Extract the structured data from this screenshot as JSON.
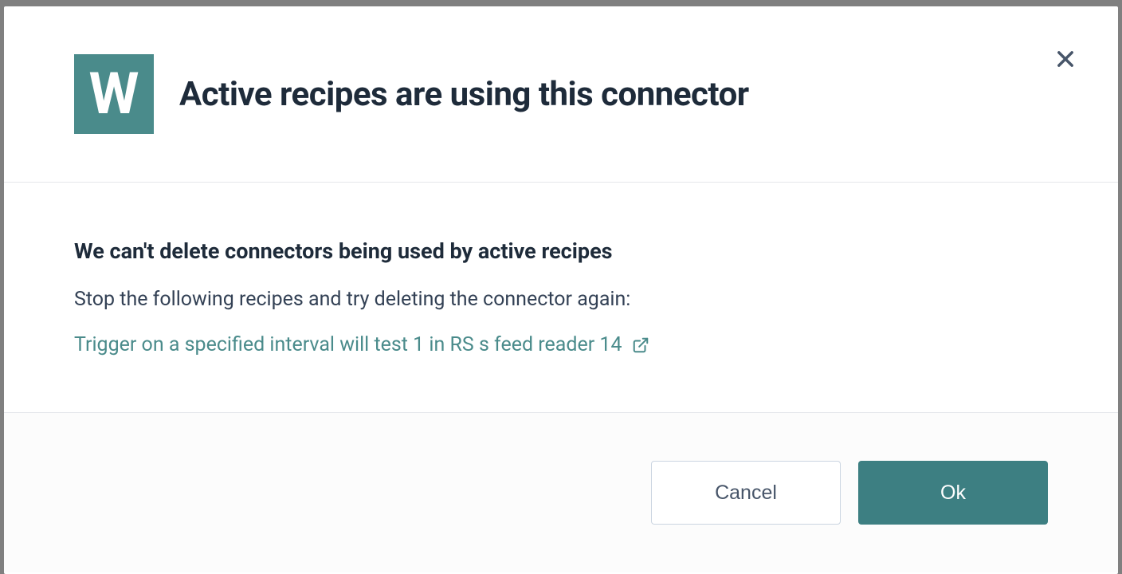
{
  "modal": {
    "icon_letter": "W",
    "title": "Active recipes are using this connector",
    "body": {
      "heading": "We can't delete connectors being used by active recipes",
      "instruction": "Stop the following recipes and try deleting the connector again:",
      "recipe_link_text": "Trigger on a specified interval will test 1 in RS s feed reader 14"
    },
    "footer": {
      "cancel_label": "Cancel",
      "ok_label": "Ok"
    }
  },
  "colors": {
    "accent": "#4a8b8b",
    "ok_button": "#3d7f82",
    "text_dark": "#1e2b3a"
  }
}
